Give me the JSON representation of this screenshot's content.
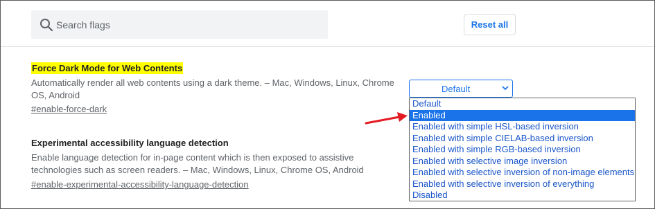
{
  "search": {
    "placeholder": "Search flags"
  },
  "header": {
    "reset_label": "Reset all"
  },
  "flags": [
    {
      "title": "Force Dark Mode for Web Contents",
      "description": "Automatically render all web contents using a dark theme. – Mac, Windows, Linux, Chrome OS, Android",
      "link": "#enable-force-dark",
      "select_value": "Default"
    },
    {
      "title": "Experimental accessibility language detection",
      "description": "Enable language detection for in-page content which is then exposed to assistive technologies such as screen readers. – Mac, Windows, Linux, Chrome OS, Android",
      "link": "#enable-experimental-accessibility-language-detection"
    }
  ],
  "dropdown": {
    "options": [
      "Default",
      "Enabled",
      "Enabled with simple HSL-based inversion",
      "Enabled with simple CIELAB-based inversion",
      "Enabled with simple RGB-based inversion",
      "Enabled with selective image inversion",
      "Enabled with selective inversion of non-image elements",
      "Enabled with selective inversion of everything",
      "Disabled"
    ],
    "highlighted": "Enabled"
  },
  "colors": {
    "accent": "#1a73e8",
    "highlight_title": "#ffff00",
    "annotation_arrow": "#e31b23"
  },
  "icons": {
    "search": "search-icon",
    "chevron": "chevron-down-icon",
    "arrow": "red-arrow-annotation"
  }
}
